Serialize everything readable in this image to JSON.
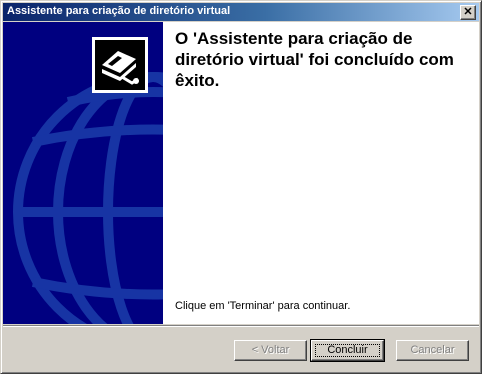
{
  "window": {
    "title": "Assistente para criação de diretório virtual",
    "close_symbol": "✕"
  },
  "banner": {
    "icon": "wizard-book-folder-icon",
    "background_color": "#000080"
  },
  "content": {
    "heading": "O 'Assistente para criação de diretório virtual' foi concluído com êxito.",
    "hint": "Clique em 'Terminar' para continuar."
  },
  "buttons": {
    "back_label": "< Voltar",
    "finish_label": "Concluir",
    "cancel_label": "Cancelar"
  }
}
